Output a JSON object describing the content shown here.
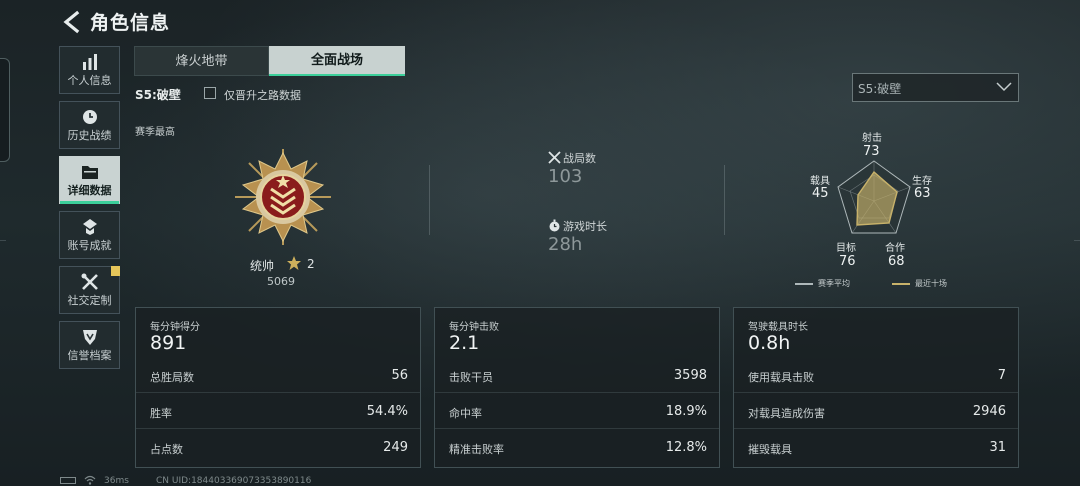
{
  "header": {
    "title": "角色信息"
  },
  "sidebar": {
    "items": [
      {
        "label": "个人信息",
        "icon": "bar-chart-icon"
      },
      {
        "label": "历史战绩",
        "icon": "clock-icon"
      },
      {
        "label": "详细数据",
        "icon": "folder-icon",
        "active": true
      },
      {
        "label": "账号成就",
        "icon": "achievement-icon"
      },
      {
        "label": "社交定制",
        "icon": "tools-icon",
        "notification": true
      },
      {
        "label": "信誉档案",
        "icon": "shield-icon"
      }
    ]
  },
  "tabs": [
    {
      "label": "烽火地带",
      "active": false
    },
    {
      "label": "全面战场",
      "active": true
    }
  ],
  "season": {
    "label": "S5:破壁",
    "checkbox_label": "仅晋升之路数据",
    "select_value": "S5:破壁"
  },
  "section_title": "赛季最高",
  "rank": {
    "name": "统帅",
    "level": "2",
    "score": "5069"
  },
  "middle_stats": [
    {
      "label": "战局数",
      "value": "103",
      "icon": "crossed-swords-icon"
    },
    {
      "label": "游戏时长",
      "value": "28h",
      "icon": "stopwatch-icon"
    }
  ],
  "radar": {
    "axes": [
      {
        "label": "射击",
        "value": "73"
      },
      {
        "label": "生存",
        "value": "63"
      },
      {
        "label": "合作",
        "value": "68"
      },
      {
        "label": "目标",
        "value": "76"
      },
      {
        "label": "载具",
        "value": "45"
      }
    ],
    "legend": [
      {
        "label": "赛季平均",
        "color": "#aeb8ba"
      },
      {
        "label": "最近十场",
        "color": "#c8b26a"
      }
    ]
  },
  "cards": [
    {
      "header": "每分钟得分",
      "value": "891",
      "rows": [
        {
          "label": "总胜局数",
          "value": "56"
        },
        {
          "label": "胜率",
          "value": "54.4%"
        },
        {
          "label": "占点数",
          "value": "249"
        }
      ]
    },
    {
      "header": "每分钟击败",
      "value": "2.1",
      "rows": [
        {
          "label": "击败干员",
          "value": "3598"
        },
        {
          "label": "命中率",
          "value": "18.9%"
        },
        {
          "label": "精准击败率",
          "value": "12.8%"
        }
      ]
    },
    {
      "header": "驾驶载具时长",
      "value": "0.8h",
      "rows": [
        {
          "label": "使用载具击败",
          "value": "7"
        },
        {
          "label": "对载具造成伤害",
          "value": "2946"
        },
        {
          "label": "摧毁载具",
          "value": "31"
        }
      ]
    }
  ],
  "status": {
    "ping": "36ms",
    "uid": "CN UID:184403369073353890116"
  },
  "colors": {
    "accent": "#3ccf9a",
    "gold": "#c8b26a",
    "notification": "#e6c65a"
  }
}
